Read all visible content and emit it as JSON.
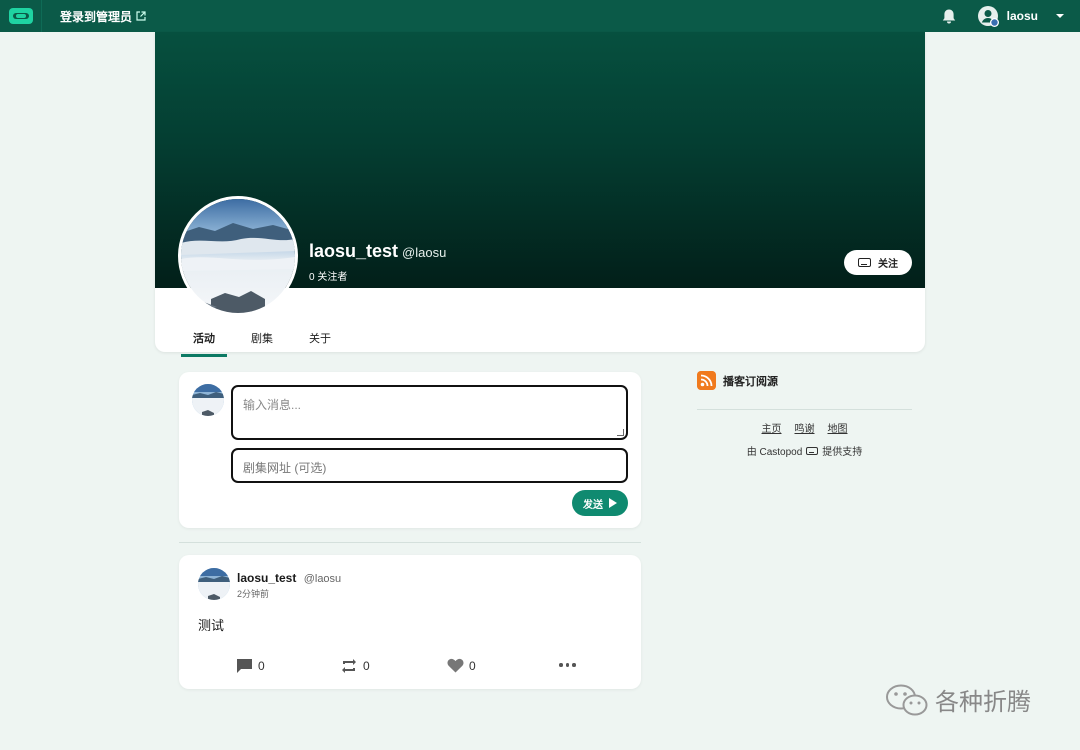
{
  "topbar": {
    "admin_link": "登录到管理员",
    "user": "laosu",
    "icons": [
      "castopod-logo",
      "external-link-icon",
      "bell-icon",
      "user-avatar-icon",
      "caret-down-icon"
    ]
  },
  "profile": {
    "display_name": "laosu_test",
    "handle": "@laosu",
    "followers": "0 关注者",
    "follow_button": "关注",
    "tabs": [
      "活动",
      "剧集",
      "关于"
    ],
    "active_tab": 0
  },
  "compose": {
    "message_placeholder": "输入消息...",
    "url_placeholder": "剧集网址 (可选)",
    "send_button": "发送"
  },
  "post": {
    "name": "laosu_test",
    "handle": "@laosu",
    "time": "2分钟前",
    "body": "测试",
    "comments": "0",
    "reblogs": "0",
    "likes": "0"
  },
  "sidebar": {
    "rss_label": "播客订阅源",
    "footer_links": [
      "主页",
      "鸣谢",
      "地图"
    ],
    "powered_prefix": "由 Castopod",
    "powered_suffix": "提供支持"
  },
  "watermark": "各种折腾",
  "colors": {
    "topbar": "#0b5a48",
    "accent": "#0f8a70",
    "page_bg": "#eef5f2",
    "rss": "#f07a1e"
  }
}
